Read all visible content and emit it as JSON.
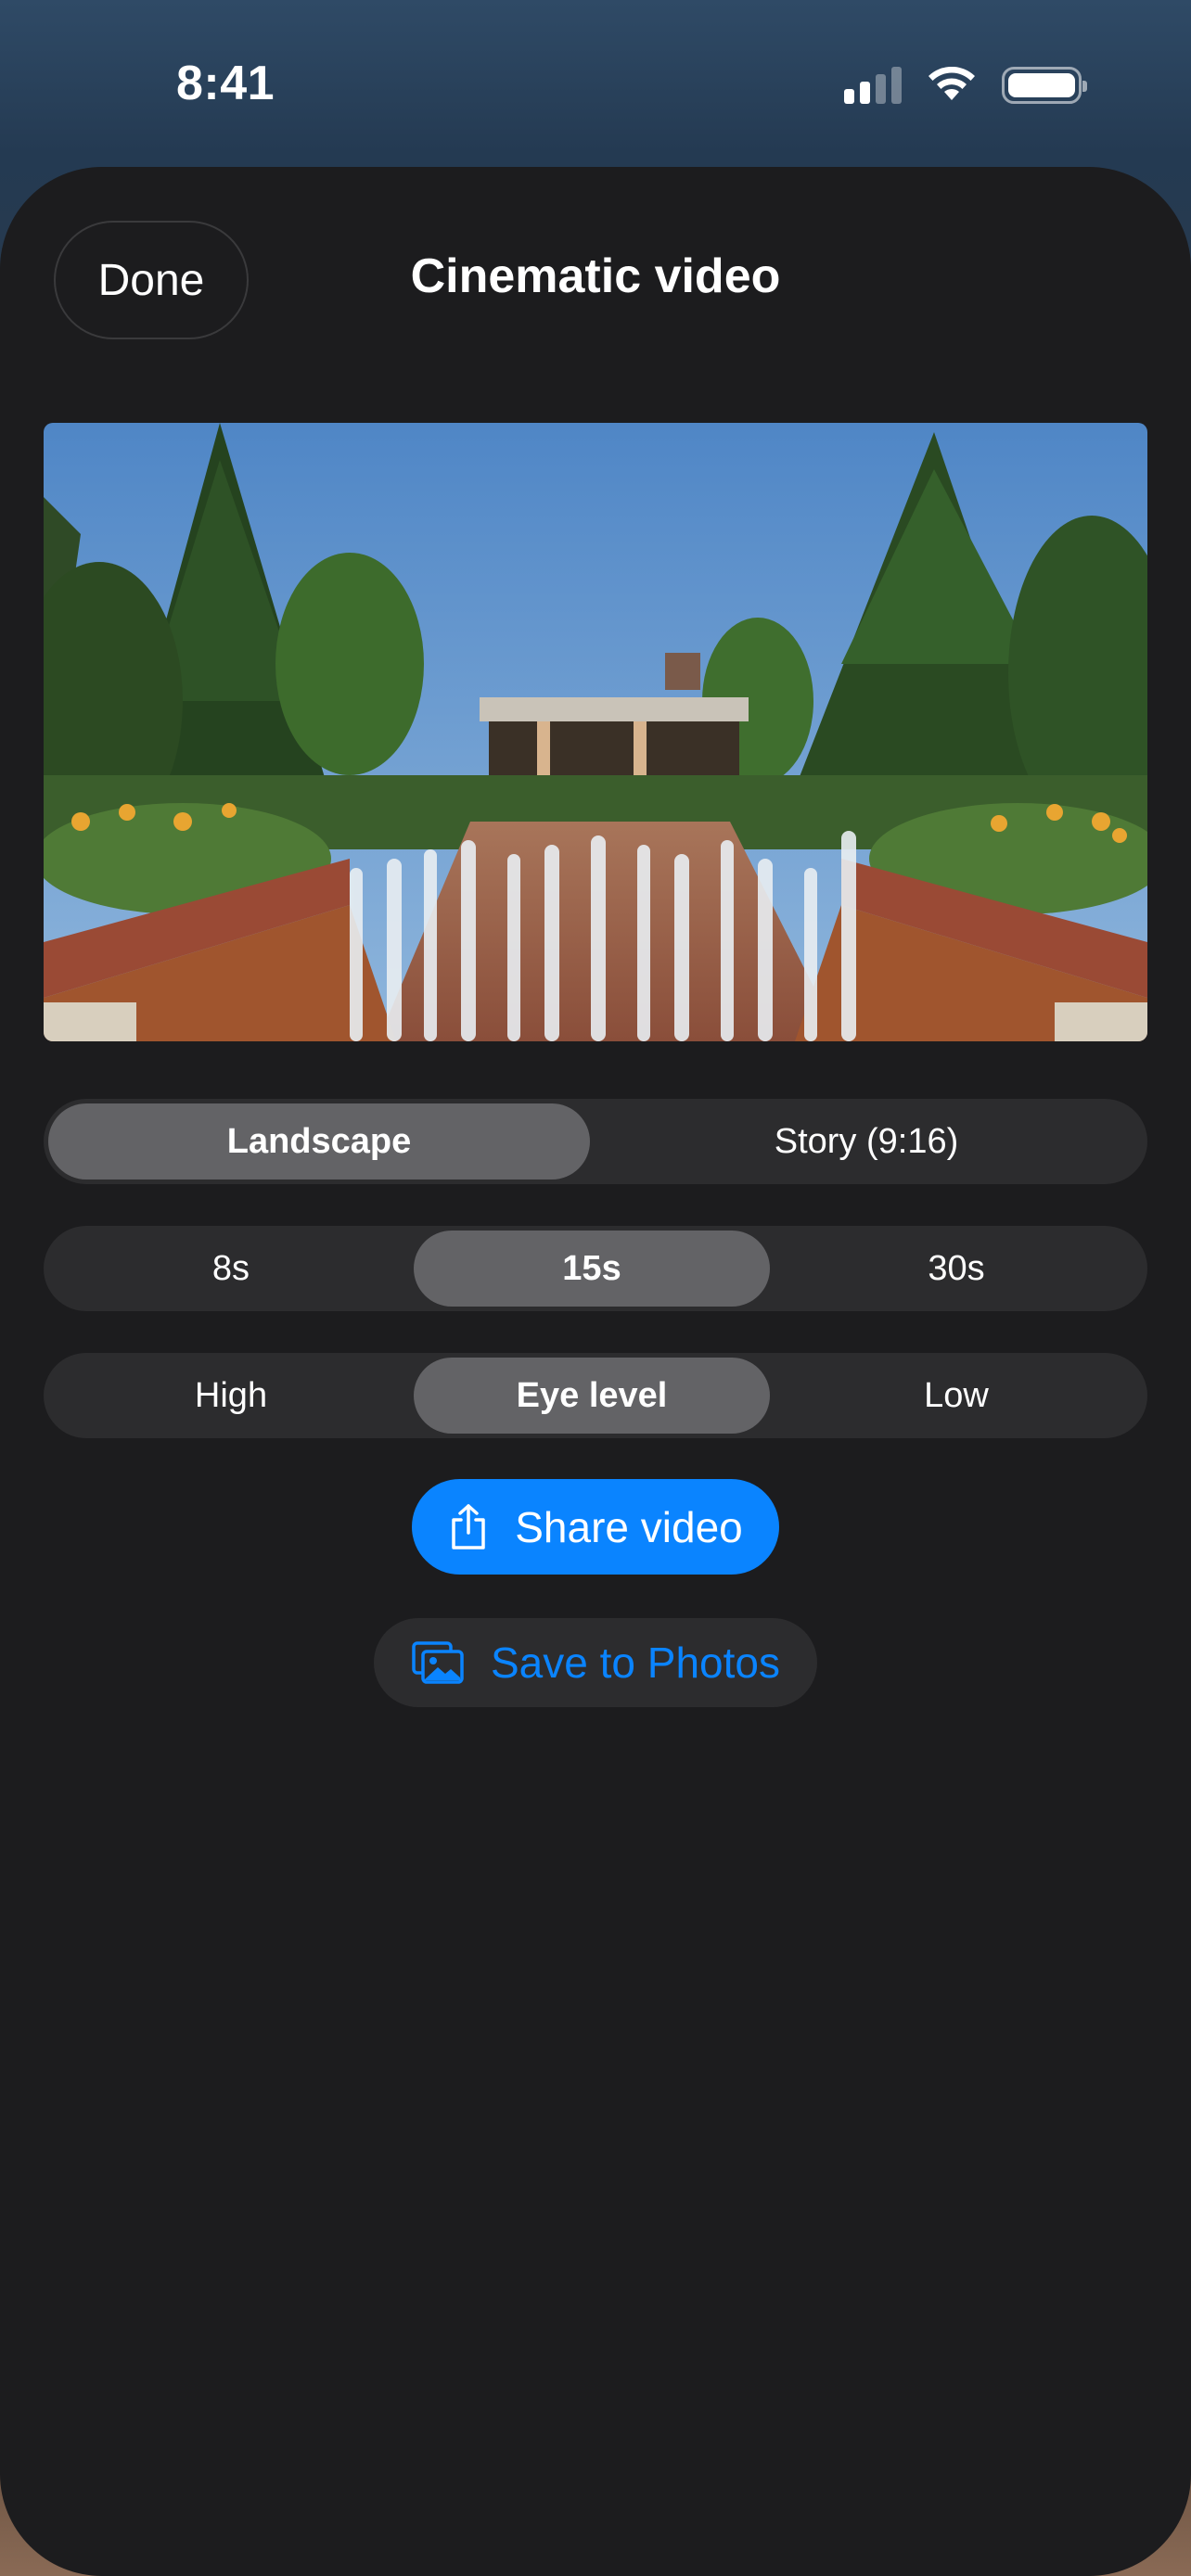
{
  "status_bar": {
    "time": "8:41",
    "icons": [
      "cellular-signal-icon",
      "wifi-icon",
      "battery-icon"
    ]
  },
  "sheet": {
    "done_label": "Done",
    "title": "Cinematic video"
  },
  "preview": {
    "image": "garden-fountain-photo",
    "description_hidden": true
  },
  "format_options": {
    "options": [
      "Landscape",
      "Story (9:16)"
    ],
    "selected": "Landscape"
  },
  "duration_options": {
    "options": [
      "8s",
      "15s",
      "30s"
    ],
    "selected": "15s"
  },
  "camera_height_options": {
    "options": [
      "High",
      "Eye level",
      "Low"
    ],
    "selected": "Eye level"
  },
  "actions": {
    "share_label": "Share video",
    "share_icon": "share-icon",
    "save_label": "Save to Photos",
    "save_icon": "photos-icon"
  },
  "colors": {
    "accent": "#0a84ff",
    "sheet_background": "#1c1c1e",
    "segment_track": "#2c2c2e",
    "segment_selected": "#636366"
  }
}
